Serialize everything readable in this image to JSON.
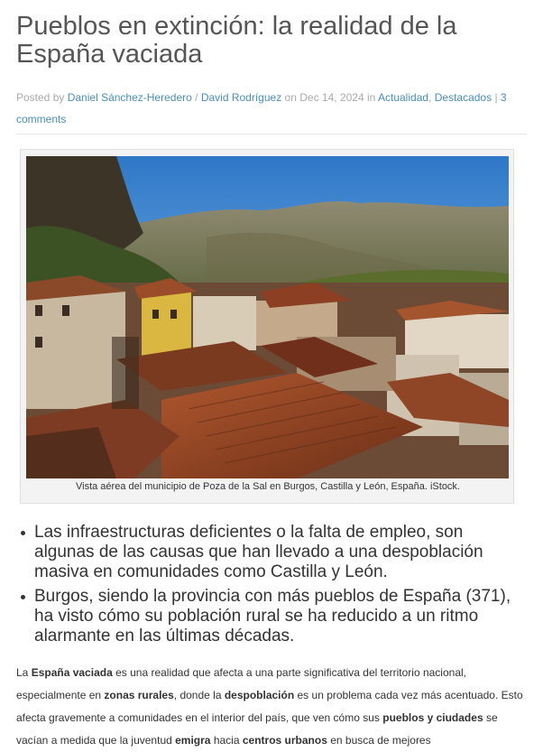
{
  "article": {
    "title": "Pueblos en extinción: la realidad de la España vaciada",
    "meta": {
      "posted_by": "Posted by",
      "author1": "Daniel Sánchez-Heredero",
      "slash": " / ",
      "author2": "David Rodríguez",
      "on": "on",
      "date": "Dec 14, 2024",
      "in": "in",
      "category1": "Actualidad",
      "comma": ",",
      "category2": "Destacados",
      "pipe": "|",
      "comments": "3 comments"
    },
    "figure": {
      "caption": "Vista aérea del municipio de Poza de la Sal en Burgos, Castilla y León, España. iStock."
    },
    "bullets": [
      "Las infraestructuras deficientes o la falta de empleo, son algunas de las causas que han llevado a una despoblación masiva en comunidades como Castilla y León.",
      "Burgos, siendo la provincia con más pueblos de España (371), ha visto cómo su población rural se ha reducido a un ritmo alarmante en las últimas décadas."
    ],
    "paragraph": {
      "s1": "La ",
      "b1": "España vaciada",
      "s2": " es una realidad que afecta a una parte significativa del territorio nacional, especialmente en ",
      "b2": "zonas rurales",
      "s3": ", donde la ",
      "b3": "despoblación",
      "s4": " es un problema cada vez más acentuado. Esto afecta gravemente a comunidades en el interior del país, que ven cómo sus ",
      "b4": "pueblos y ciudades",
      "s5": " se vacían a medida que la juventud ",
      "b5": "emigra",
      "s6": " hacia ",
      "b6": "centros urbanos",
      "s7": " en busca de mejores"
    }
  },
  "colors": {
    "title": "#555555",
    "meta": "#aaaaaa",
    "link": "#4a8fb6",
    "text": "#333333"
  }
}
